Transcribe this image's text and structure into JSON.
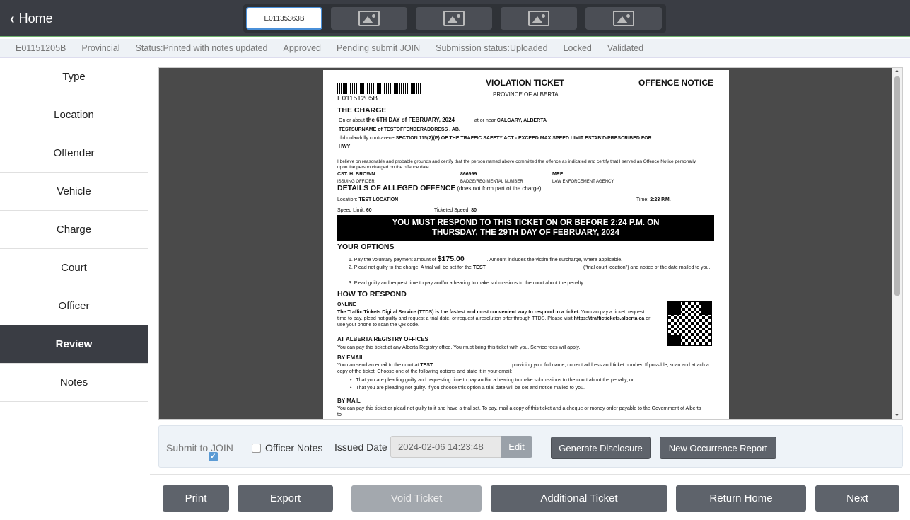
{
  "header": {
    "home_label": "Home",
    "active_tab": "E01135363B",
    "thumb_icon": "image-icon"
  },
  "status": {
    "items": [
      "E01151205B",
      "Provincial",
      "Status:Printed with notes updated",
      "Approved",
      "Pending submit JOIN",
      "Submission status:Uploaded",
      "Locked",
      "Validated"
    ]
  },
  "sidebar": {
    "items": [
      "Type",
      "Location",
      "Offender",
      "Vehicle",
      "Charge",
      "Court",
      "Officer",
      "Review",
      "Notes"
    ],
    "active": "Review"
  },
  "ticket": {
    "number": "E01151205B",
    "title": "VIOLATION TICKET",
    "province": "PROVINCE OF ALBERTA",
    "notice": "OFFENCE NOTICE",
    "the_charge": "THE CHARGE",
    "on_about": "On or about",
    "date": "the 6TH DAY of FEBRUARY, 2024",
    "at_near": "at or near",
    "place": "CALGARY, ALBERTA",
    "offender": "TESTSURNAME of TESTOFFENDERADDRESS , AB.",
    "contravene_prefix": "did unlawfully contravene",
    "section": "SECTION 115(2)(P) OF THE TRAFFIC SAFETY ACT - EXCEED MAX SPEED LIMIT ESTAB'D/PRESCRIBED FOR",
    "hwy": "HWY",
    "belief": "I believe on reasonable and probable grounds and certify that the person named above committed the offence as indicated and certify that I served an Offence Notice personally upon the person charged on the offence date.",
    "officer": "CST. H. BROWN",
    "badge": "866999",
    "agency": "MRF",
    "officer_lbl": "ISSUING OFFICER",
    "badge_lbl": "BADGE/REGIMENTAL NUMBER",
    "agency_lbl": "LAW ENFORCEMENT AGENCY",
    "details_head": "DETAILS OF ALLEGED OFFENCE",
    "details_note": "(does not form part of the charge)",
    "location_lbl": "Location:",
    "location": "TEST LOCATION",
    "time_lbl": "Time:",
    "time": "2:23 P.M.",
    "speed_limit_lbl": "Speed Limit:",
    "speed_limit": "60",
    "ticketed_speed_lbl": "Ticketed Speed:",
    "ticketed_speed": "80",
    "banner_1": "YOU MUST RESPOND TO THIS TICKET ON OR BEFORE  2:24 P.M.     ON",
    "banner_2": "THURSDAY, THE 29TH DAY OF FEBRUARY, 2024",
    "options_head": "YOUR OPTIONS",
    "opt1_a": "1.    Pay the voluntary payment amount of",
    "amount": "$175.00",
    "opt1_b": ". Amount includes the victim fine surcharge, where applicable.",
    "opt2_a": "2.    Plead not guilty to the charge. A trial will be set for the",
    "court": "TEST",
    "opt2_b": "(\"trial court location\") and notice of the date mailed to you.",
    "opt3": "3.    Plead guilty and request time to pay and/or a hearing to make submissions to the court about the penalty.",
    "respond_head": "HOW TO RESPOND",
    "online": "ONLINE",
    "online_text_b": "The Traffic Tickets Digital Service (TTDS) is the fastest and most convenient way to respond to a ticket.",
    "online_text": "You can pay a ticket, request time to pay, plead not guilty and request a trial date, or request a resolution offer through TTDS. Please visit",
    "url": "https://traffictickets.alberta.ca",
    "url_tail": "or use your phone to scan the QR code.",
    "registry_head": "AT ALBERTA REGISTRY OFFICES",
    "registry_text": "You can pay this ticket at any Alberta Registry office. You must bring this ticket with you. Service fees will apply.",
    "email_head": "BY EMAIL",
    "email_a": "You can send an email to the court at",
    "email_court": "TEST",
    "email_b": "providing your full name, current address and ticket number. If possible, scan and attach a copy of the ticket. Choose one of the following options and state it in your email:",
    "bullet1": "That you are pleading guilty and requesting time to pay and/or a hearing to make submissions to the court about the penalty, or",
    "bullet2": "That you are pleading not guilty. If you choose this option a trial date will be set and notice mailed to you.",
    "mail_head": "BY MAIL",
    "mail_text": "You can pay this ticket or plead not guilty to it and have a trial set. To pay, mail a copy of this ticket and a cheque or money order payable to the Government of Alberta to"
  },
  "options": {
    "submit_join": "Submit to JOIN",
    "submit_join_checked": true,
    "officer_notes": "Officer Notes",
    "officer_notes_checked": false,
    "issued_date_label": "Issued Date",
    "issued_date": "2024-02-06 14:23:48",
    "edit": "Edit",
    "generate_disclosure": "Generate Disclosure",
    "new_occurrence": "New Occurrence Report"
  },
  "actions": {
    "print": "Print",
    "export": "Export",
    "void": "Void Ticket",
    "additional": "Additional Ticket",
    "return_home": "Return Home",
    "next": "Next"
  },
  "colors": {
    "dark": "#3a3d44",
    "button": "#5e636b",
    "accent": "#5b9bd5"
  }
}
